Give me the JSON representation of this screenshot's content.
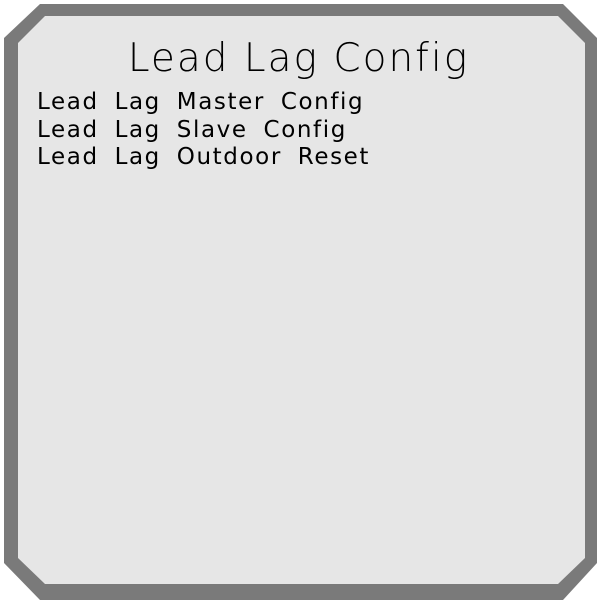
{
  "screen": {
    "title": "Lead Lag Config",
    "menu_items": [
      {
        "label": "Lead Lag Master Config"
      },
      {
        "label": "Lead Lag Slave Config"
      },
      {
        "label": "Lead Lag Outdoor Reset"
      }
    ]
  },
  "colors": {
    "frame_border": "#7a7a7a",
    "panel_background": "#e6e6e6",
    "text": "#000000"
  }
}
